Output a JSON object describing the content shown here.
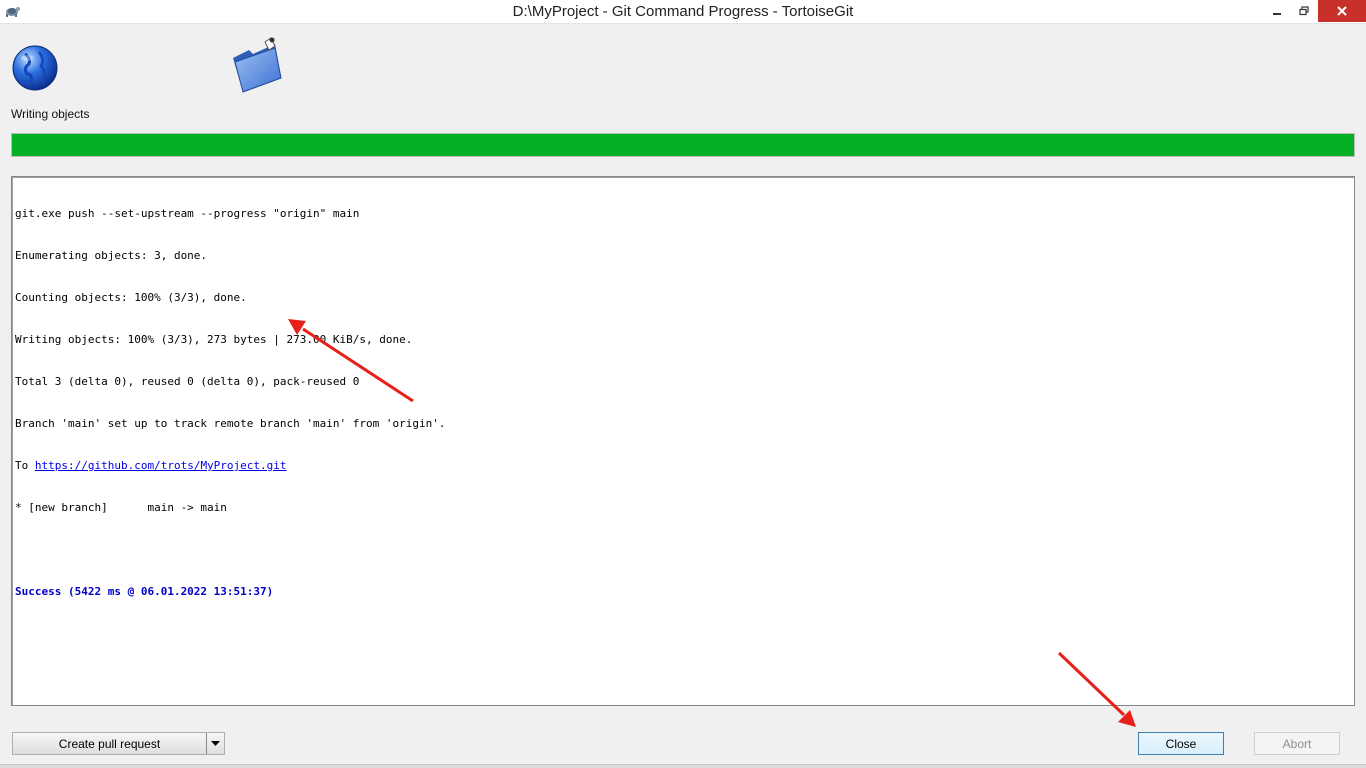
{
  "window": {
    "title": "D:\\MyProject - Git Command Progress - TortoiseGit",
    "close_color": "#c7312a"
  },
  "status": {
    "label": "Writing objects",
    "progress": 1.0,
    "progress_color": "#06b025"
  },
  "log": {
    "lines": [
      "git.exe push --set-upstream --progress \"origin\" main",
      "Enumerating objects: 3, done.",
      "Counting objects: 100% (3/3), done.",
      "Writing objects: 100% (3/3), 273 bytes | 273.00 KiB/s, done.",
      "Total 3 (delta 0), reused 0 (delta 0), pack-reused 0",
      "Branch 'main' set up to track remote branch 'main' from 'origin'."
    ],
    "to_prefix": "To ",
    "remote_url": "https://github.com/trots/MyProject.git",
    "branch_line": "* [new branch]      main -> main",
    "success": "Success (5422 ms @ 06.01.2022 13:51:37)",
    "success_color": "#0000c8"
  },
  "buttons": {
    "create_pr": "Create pull request",
    "close": "Close",
    "abort": "Abort"
  },
  "annotation": {
    "arrow_color": "#e8201a"
  },
  "icons": {
    "app": "tortoisegit-icon",
    "globe": "globe-icon",
    "folder": "folder-icon"
  }
}
